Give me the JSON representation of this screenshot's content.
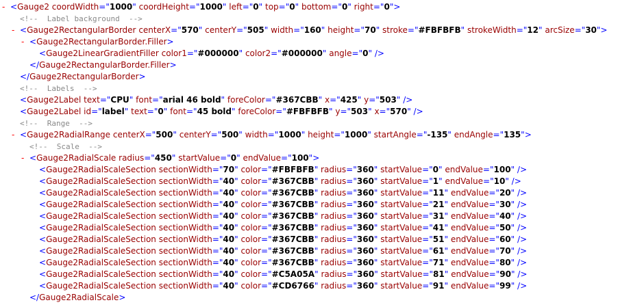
{
  "toggle_glyph": "-",
  "lines": [
    {
      "indent": 0,
      "toggle": true,
      "kind": "open",
      "tag": "Gauge2",
      "attrs": [
        [
          "coordWidth",
          "1000"
        ],
        [
          "coordHeight",
          "1000"
        ],
        [
          "left",
          "0"
        ],
        [
          "top",
          "0"
        ],
        [
          "bottom",
          "0"
        ],
        [
          "right",
          "0"
        ]
      ]
    },
    {
      "indent": 1,
      "toggle": false,
      "kind": "comment",
      "text": "<!--  Label background  -->"
    },
    {
      "indent": 1,
      "toggle": true,
      "kind": "open",
      "tag": "Gauge2RectangularBorder",
      "attrs": [
        [
          "centerX",
          "570"
        ],
        [
          "centerY",
          "505"
        ],
        [
          "width",
          "160"
        ],
        [
          "height",
          "70"
        ],
        [
          "stroke",
          "#FBFBFB"
        ],
        [
          "strokeWidth",
          "12"
        ],
        [
          "arcSize",
          "30"
        ]
      ]
    },
    {
      "indent": 2,
      "toggle": true,
      "kind": "open",
      "tag": "Gauge2RectangularBorder.Filler",
      "attrs": []
    },
    {
      "indent": 3,
      "toggle": false,
      "kind": "self",
      "tag": "Gauge2LinearGradientFiller",
      "attrs": [
        [
          "color1",
          "#000000"
        ],
        [
          "color2",
          "#000000"
        ],
        [
          "angle",
          "0"
        ]
      ]
    },
    {
      "indent": 2,
      "toggle": false,
      "kind": "close",
      "tag": "Gauge2RectangularBorder.Filler"
    },
    {
      "indent": 1,
      "toggle": false,
      "kind": "close",
      "tag": "Gauge2RectangularBorder"
    },
    {
      "indent": 1,
      "toggle": false,
      "kind": "comment",
      "text": "<!--  Labels  -->"
    },
    {
      "indent": 1,
      "toggle": false,
      "kind": "self",
      "tag": "Gauge2Label",
      "attrs": [
        [
          "text",
          "CPU"
        ],
        [
          "font",
          "arial 46 bold"
        ],
        [
          "foreColor",
          "#367CBB"
        ],
        [
          "x",
          "425"
        ],
        [
          "y",
          "503"
        ]
      ]
    },
    {
      "indent": 1,
      "toggle": false,
      "kind": "self",
      "tag": "Gauge2Label",
      "attrs": [
        [
          "id",
          "label"
        ],
        [
          "text",
          "0"
        ],
        [
          "font",
          "45 bold"
        ],
        [
          "foreColor",
          "#FBFBFB"
        ],
        [
          "y",
          "503"
        ],
        [
          "x",
          "570"
        ]
      ]
    },
    {
      "indent": 1,
      "toggle": false,
      "kind": "comment",
      "text": "<!--  Range  -->"
    },
    {
      "indent": 1,
      "toggle": true,
      "kind": "open",
      "tag": "Gauge2RadialRange",
      "attrs": [
        [
          "centerX",
          "500"
        ],
        [
          "centerY",
          "500"
        ],
        [
          "width",
          "1000"
        ],
        [
          "height",
          "1000"
        ],
        [
          "startAngle",
          "-135"
        ],
        [
          "endAngle",
          "135"
        ]
      ]
    },
    {
      "indent": 2,
      "toggle": false,
      "kind": "comment",
      "text": "<!--  Scale  -->"
    },
    {
      "indent": 2,
      "toggle": true,
      "kind": "open",
      "tag": "Gauge2RadialScale",
      "attrs": [
        [
          "radius",
          "450"
        ],
        [
          "startValue",
          "0"
        ],
        [
          "endValue",
          "100"
        ]
      ]
    },
    {
      "indent": 3,
      "toggle": false,
      "kind": "self",
      "tag": "Gauge2RadialScaleSection",
      "attrs": [
        [
          "sectionWidth",
          "70"
        ],
        [
          "color",
          "#FBFBFB"
        ],
        [
          "radius",
          "360"
        ],
        [
          "startValue",
          "0"
        ],
        [
          "endValue",
          "100"
        ]
      ]
    },
    {
      "indent": 3,
      "toggle": false,
      "kind": "self",
      "tag": "Gauge2RadialScaleSection",
      "attrs": [
        [
          "sectionWidth",
          "40"
        ],
        [
          "color",
          "#367CBB"
        ],
        [
          "radius",
          "360"
        ],
        [
          "startValue",
          "1"
        ],
        [
          "endValue",
          "10"
        ]
      ]
    },
    {
      "indent": 3,
      "toggle": false,
      "kind": "self",
      "tag": "Gauge2RadialScaleSection",
      "attrs": [
        [
          "sectionWidth",
          "40"
        ],
        [
          "color",
          "#367CBB"
        ],
        [
          "radius",
          "360"
        ],
        [
          "startValue",
          "11"
        ],
        [
          "endValue",
          "20"
        ]
      ]
    },
    {
      "indent": 3,
      "toggle": false,
      "kind": "self",
      "tag": "Gauge2RadialScaleSection",
      "attrs": [
        [
          "sectionWidth",
          "40"
        ],
        [
          "color",
          "#367CBB"
        ],
        [
          "radius",
          "360"
        ],
        [
          "startValue",
          "21"
        ],
        [
          "endValue",
          "30"
        ]
      ]
    },
    {
      "indent": 3,
      "toggle": false,
      "kind": "self",
      "tag": "Gauge2RadialScaleSection",
      "attrs": [
        [
          "sectionWidth",
          "40"
        ],
        [
          "color",
          "#367CBB"
        ],
        [
          "radius",
          "360"
        ],
        [
          "startValue",
          "31"
        ],
        [
          "endValue",
          "40"
        ]
      ]
    },
    {
      "indent": 3,
      "toggle": false,
      "kind": "self",
      "tag": "Gauge2RadialScaleSection",
      "attrs": [
        [
          "sectionWidth",
          "40"
        ],
        [
          "color",
          "#367CBB"
        ],
        [
          "radius",
          "360"
        ],
        [
          "startValue",
          "41"
        ],
        [
          "endValue",
          "50"
        ]
      ]
    },
    {
      "indent": 3,
      "toggle": false,
      "kind": "self",
      "tag": "Gauge2RadialScaleSection",
      "attrs": [
        [
          "sectionWidth",
          "40"
        ],
        [
          "color",
          "#367CBB"
        ],
        [
          "radius",
          "360"
        ],
        [
          "startValue",
          "51"
        ],
        [
          "endValue",
          "60"
        ]
      ]
    },
    {
      "indent": 3,
      "toggle": false,
      "kind": "self",
      "tag": "Gauge2RadialScaleSection",
      "attrs": [
        [
          "sectionWidth",
          "40"
        ],
        [
          "color",
          "#367CBB"
        ],
        [
          "radius",
          "360"
        ],
        [
          "startValue",
          "61"
        ],
        [
          "endValue",
          "70"
        ]
      ]
    },
    {
      "indent": 3,
      "toggle": false,
      "kind": "self",
      "tag": "Gauge2RadialScaleSection",
      "attrs": [
        [
          "sectionWidth",
          "40"
        ],
        [
          "color",
          "#367CBB"
        ],
        [
          "radius",
          "360"
        ],
        [
          "startValue",
          "71"
        ],
        [
          "endValue",
          "80"
        ]
      ]
    },
    {
      "indent": 3,
      "toggle": false,
      "kind": "self",
      "tag": "Gauge2RadialScaleSection",
      "attrs": [
        [
          "sectionWidth",
          "40"
        ],
        [
          "color",
          "#C5A05A"
        ],
        [
          "radius",
          "360"
        ],
        [
          "startValue",
          "81"
        ],
        [
          "endValue",
          "90"
        ]
      ]
    },
    {
      "indent": 3,
      "toggle": false,
      "kind": "self",
      "tag": "Gauge2RadialScaleSection",
      "attrs": [
        [
          "sectionWidth",
          "40"
        ],
        [
          "color",
          "#CD6766"
        ],
        [
          "radius",
          "360"
        ],
        [
          "startValue",
          "91"
        ],
        [
          "endValue",
          "99"
        ]
      ]
    },
    {
      "indent": 2,
      "toggle": false,
      "kind": "close",
      "tag": "Gauge2RadialScale"
    }
  ]
}
